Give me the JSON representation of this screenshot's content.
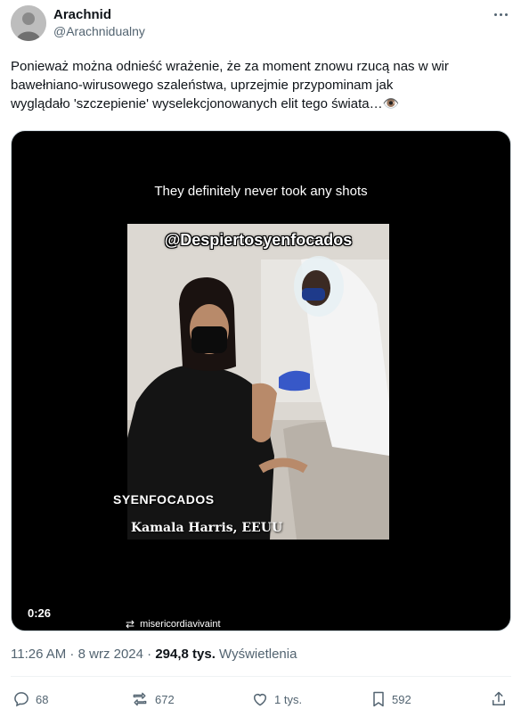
{
  "author": {
    "name": "Arachnid",
    "handle": "@Arachnidualny"
  },
  "tweet": {
    "text_lines": [
      "Ponieważ można odnieść wrażenie, że za moment znowu rzucą nas w wir",
      "bawełniano-wirusowego szaleństwa, uprzejmie przypominam jak",
      "wyglądało 'szczepienie' wyselekcjonowanych elit tego świata…👁️"
    ]
  },
  "video": {
    "caption": "They definitely never took any shots",
    "watermark": "@Despiertosyenfocados",
    "subtitle_1": "SYENFOCADOS",
    "subtitle_2": "Kamala Harris, EEUU",
    "duration": "0:26",
    "attribution": "misericordiavivaint"
  },
  "meta": {
    "time": "11:26 AM",
    "dot1": " · ",
    "date": "8 wrz 2024",
    "dot2": " · ",
    "views_count": "294,8 tys.",
    "views_label": " Wyświetlenia"
  },
  "actions": {
    "replies": "68",
    "reposts": "672",
    "likes": "1 tys.",
    "bookmarks": "592"
  },
  "icons": [
    "more-icon",
    "reply-icon",
    "repost-icon",
    "like-icon",
    "bookmark-icon",
    "share-icon"
  ]
}
